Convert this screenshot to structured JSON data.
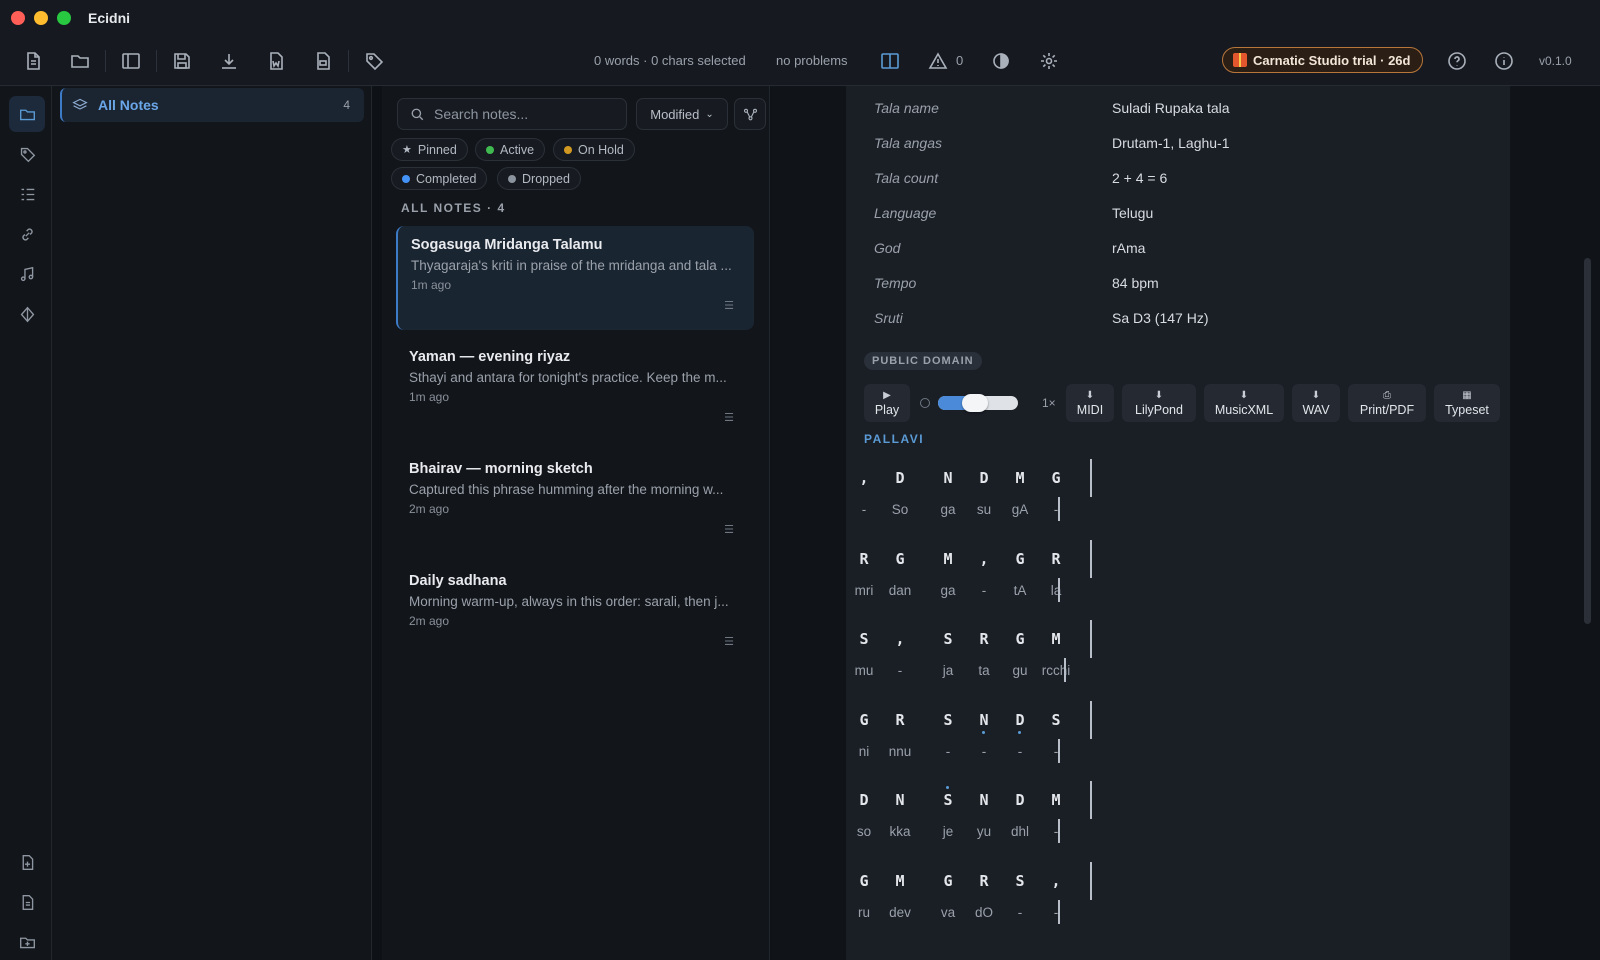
{
  "window": {
    "title": "Ecidni"
  },
  "toolbar": {
    "stats": "0 words · 0 chars selected",
    "problems": "no problems",
    "warning_count": "0",
    "trial_label": "Carnatic Studio trial · 26d",
    "version": "v0.1.0"
  },
  "folders": {
    "items": [
      {
        "label": "All Notes",
        "count": "4"
      }
    ]
  },
  "notes_list": {
    "search_placeholder": "Search notes...",
    "sort_label": "Modified",
    "section_title": "ALL NOTES · 4",
    "filters": [
      {
        "label": "Pinned",
        "icon": "star-icon"
      },
      {
        "label": "Active",
        "color": "#3fb950"
      },
      {
        "label": "On Hold",
        "color": "#d29922"
      },
      {
        "label": "Completed",
        "color": "#4493f8"
      },
      {
        "label": "Dropped",
        "color": "#8b949e"
      }
    ],
    "notes": [
      {
        "title": "Sogasuga Mridanga Talamu",
        "excerpt": "Thyagaraja's kriti in praise of the mridanga and tala ...",
        "time": "1m ago",
        "selected": true
      },
      {
        "title": "Yaman — evening riyaz",
        "excerpt": "Sthayi and antara for tonight's practice. Keep the m...",
        "time": "1m ago"
      },
      {
        "title": "Bhairav — morning sketch",
        "excerpt": "Captured this phrase humming after the morning w...",
        "time": "2m ago"
      },
      {
        "title": "Daily sadhana",
        "excerpt": "Morning warm-up, always in this order: sarali, then j...",
        "time": "2m ago"
      }
    ]
  },
  "editor": {
    "metadata": [
      {
        "key": "Tala name",
        "value": "Suladi Rupaka tala"
      },
      {
        "key": "Tala angas",
        "value": "Drutam-1, Laghu-1"
      },
      {
        "key": "Tala count",
        "value": "2 + 4 = 6"
      },
      {
        "key": "Language",
        "value": "Telugu"
      },
      {
        "key": "God",
        "value": "rAma"
      },
      {
        "key": "Tempo",
        "value": "84 bpm"
      },
      {
        "key": "Sruti",
        "value": "Sa D3 (147 Hz)"
      }
    ],
    "badge": "PUBLIC DOMAIN",
    "controls": {
      "play": "Play",
      "speed": "1×",
      "tempo_slider_fraction": 0.38,
      "exports": [
        {
          "label": "MIDI",
          "icon": "⬇"
        },
        {
          "label": "LilyPond",
          "icon": "⬇"
        },
        {
          "label": "MusicXML",
          "icon": "⬇"
        },
        {
          "label": "WAV",
          "icon": "⬇"
        },
        {
          "label": "Print/PDF",
          "icon": "⎙"
        },
        {
          "label": "Typeset",
          "icon": "▦"
        }
      ]
    },
    "section_label": "PALLAVI",
    "notation_rows": [
      {
        "swaras": [
          ",",
          "D",
          "N",
          "D",
          "M",
          "G"
        ],
        "lyrics": [
          "-",
          "So",
          "ga",
          "su",
          "gA",
          "-"
        ]
      },
      {
        "swaras": [
          "R",
          "G",
          "M",
          ",",
          "G",
          "R"
        ],
        "lyrics": [
          "mri",
          "dan",
          "ga",
          "-",
          "tA",
          "la"
        ]
      },
      {
        "swaras": [
          "S",
          ",",
          "S",
          "R",
          "G",
          "M"
        ],
        "lyrics": [
          "mu",
          "-",
          "ja",
          "ta",
          "gu",
          "rcchi"
        ]
      },
      {
        "swaras": [
          "G",
          "R",
          "S",
          "N",
          "D",
          "S"
        ],
        "lyrics": [
          "ni",
          "nnu",
          "-",
          "-",
          "-",
          "-"
        ],
        "lower_octave": [
          3,
          4
        ]
      },
      {
        "swaras": [
          "D",
          "N",
          "S",
          "N",
          "D",
          "M"
        ],
        "lyrics": [
          "so",
          "kka",
          "je",
          "yu",
          "dhl",
          "-"
        ],
        "upper_octave": [
          2
        ]
      },
      {
        "swaras": [
          "G",
          "M",
          "G",
          "R",
          "S",
          ","
        ],
        "lyrics": [
          "ru",
          "dev",
          "va",
          "dO",
          "-",
          "-"
        ]
      }
    ]
  }
}
